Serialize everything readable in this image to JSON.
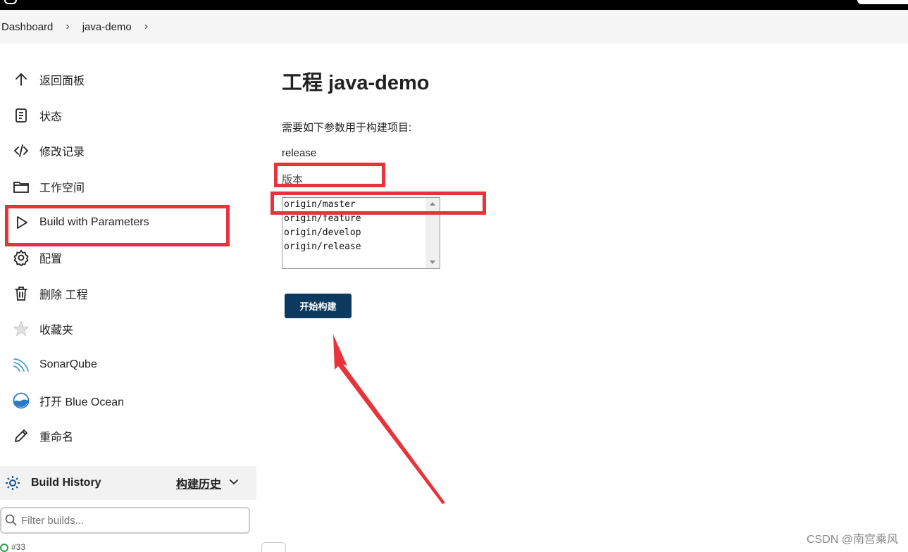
{
  "breadcrumb": {
    "items": [
      "Dashboard",
      "java-demo"
    ],
    "sep": "›"
  },
  "sidebar": {
    "items": [
      {
        "label": "返回面板",
        "icon": "arrow-up-icon"
      },
      {
        "label": "状态",
        "icon": "document-icon"
      },
      {
        "label": "修改记录",
        "icon": "code-icon"
      },
      {
        "label": "工作空间",
        "icon": "folder-icon"
      },
      {
        "label": "Build with Parameters",
        "icon": "play-icon"
      },
      {
        "label": "配置",
        "icon": "gear-icon"
      },
      {
        "label": "删除 工程",
        "icon": "trash-icon"
      },
      {
        "label": "收藏夹",
        "icon": "star-icon"
      },
      {
        "label": "SonarQube",
        "icon": "sonarqube-icon"
      },
      {
        "label": "打开 Blue Ocean",
        "icon": "blue-ocean-icon"
      },
      {
        "label": "重命名",
        "icon": "pencil-icon"
      }
    ]
  },
  "build_history": {
    "title": "Build History",
    "link": "构建历史",
    "filter_placeholder": "Filter builds...",
    "partial_row": "#33"
  },
  "main": {
    "title": "工程 java-demo",
    "description": "需要如下参数用于构建项目:",
    "param_name": "release",
    "param_description": "版本",
    "options": [
      "origin/master",
      "origin/feature",
      "origin/develop",
      "origin/release"
    ],
    "build_button": "开始构建"
  },
  "watermark": "CSDN @南宫乘风",
  "colors": {
    "highlight": "#e8333a",
    "button": "#0b3a5e",
    "breadcrumb_bg": "#f5f5f5"
  }
}
